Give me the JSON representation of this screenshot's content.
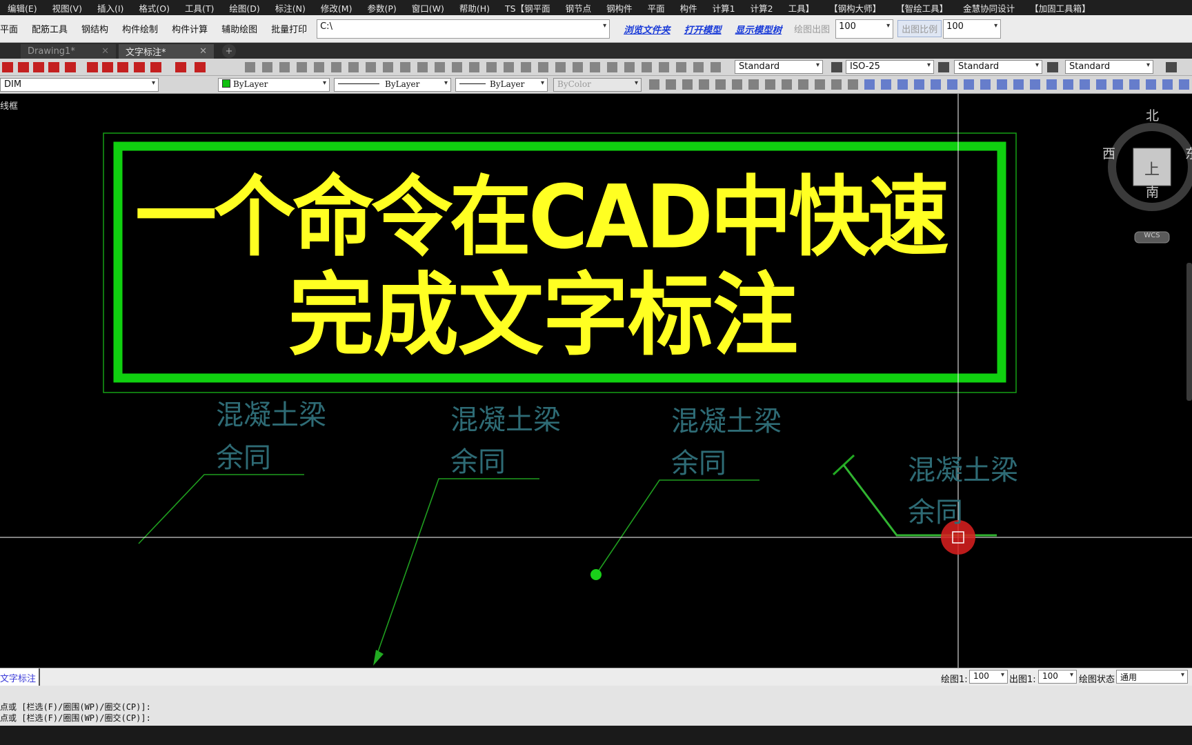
{
  "menu": [
    "编辑(E)",
    "视图(V)",
    "插入(I)",
    "格式(O)",
    "工具(T)",
    "绘图(D)",
    "标注(N)",
    "修改(M)",
    "参数(P)",
    "窗口(W)",
    "帮助(H)",
    "TS【钢平面",
    "钢节点",
    "钢构件",
    "平面",
    "构件",
    "计算1",
    "计算2",
    "工具】",
    "【钢构大师】",
    "【智绘工具】",
    "金慧协同设计",
    "【加固工具箱】"
  ],
  "toolbar": {
    "items": [
      "平面",
      "配筋工具",
      "钢结构",
      "构件绘制",
      "构件计算",
      "辅助绘图",
      "批量打印"
    ],
    "path_value": "C:\\",
    "links": [
      "浏览文件夹",
      "打开模型",
      "显示模型树"
    ],
    "draw_out_label": "绘图出图",
    "draw_out_value": "100",
    "out_scale_label": "出图比例",
    "out_scale_value": "100"
  },
  "tabs": [
    {
      "label": "Drawing1*",
      "active": false
    },
    {
      "label": "文字标注*",
      "active": true
    }
  ],
  "styles": {
    "text_style": "Standard",
    "dim_style": "ISO-25",
    "table_style": "Standard",
    "multileader_style": "Standard"
  },
  "layer_bar": {
    "layer": "DIM",
    "color": "ByLayer",
    "linetype": "ByLayer",
    "lineweight": "ByLayer",
    "plotstyle": "ByColor"
  },
  "viewport_label": "线框",
  "title": {
    "line1": "一个命令在CAD中快速",
    "line2": "完成文字标注"
  },
  "annotations": [
    {
      "top": "混凝土梁",
      "bottom": "余同"
    },
    {
      "top": "混凝土梁",
      "bottom": "余同"
    },
    {
      "top": "混凝土梁",
      "bottom": "余同"
    },
    {
      "top": "混凝土梁",
      "bottom": "余同"
    }
  ],
  "viewcube": {
    "north": "北",
    "south": "南",
    "west": "西",
    "east": "东",
    "top": "上",
    "wcs": "WCS"
  },
  "status": {
    "active_tab": "文字标注",
    "draw_scale_label": "绘图1:",
    "draw_scale_value": "100",
    "out_scale_label": "出图1:",
    "out_scale_value": "100",
    "state_label": "绘图状态",
    "state_value": "通用"
  },
  "command_lines": [
    "点或 [栏选(F)/圈围(WP)/圈交(CP)]:",
    "点或 [栏选(F)/圈围(WP)/圈交(CP)]:"
  ],
  "colors": {
    "title_text": "#ffff22",
    "frame": "#10d010",
    "label_text": "#2e6b75",
    "leader": "#22aa22"
  }
}
